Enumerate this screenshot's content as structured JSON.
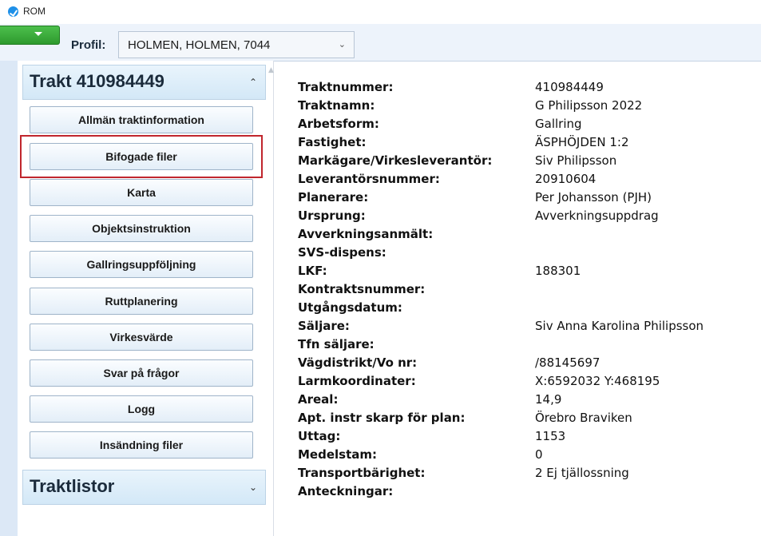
{
  "app": {
    "title": "ROM"
  },
  "toolbar": {
    "profile_label": "Profil:",
    "profile_value": "HOLMEN, HOLMEN, 7044"
  },
  "colors": {
    "accent_green": "#3aa83a",
    "selection_red": "#c0262d",
    "panel_blue": "#dce8f6"
  },
  "sidebar": {
    "trakt_header": "Trakt 410984449",
    "traktlistor_header": "Traktlistor",
    "selected_item": "Bifogade filer",
    "items": [
      {
        "label": "Allmän traktinformation"
      },
      {
        "label": "Bifogade filer"
      },
      {
        "label": "Karta"
      },
      {
        "label": "Objektsinstruktion"
      },
      {
        "label": "Gallringsuppföljning"
      },
      {
        "label": "Ruttplanering"
      },
      {
        "label": "Virkesvärde"
      },
      {
        "label": "Svar på frågor"
      },
      {
        "label": "Logg"
      },
      {
        "label": "Insändning filer"
      }
    ]
  },
  "details": [
    {
      "label": "Traktnummer:",
      "value": "410984449"
    },
    {
      "label": "Traktnamn:",
      "value": "G Philipsson 2022"
    },
    {
      "label": "Arbetsform:",
      "value": "Gallring"
    },
    {
      "label": "Fastighet:",
      "value": "ÄSPHÖJDEN 1:2"
    },
    {
      "label": "Markägare/Virkesleverantör:",
      "value": "Siv Philipsson"
    },
    {
      "label": "Leverantörsnummer:",
      "value": "20910604"
    },
    {
      "label": "Planerare:",
      "value": "Per Johansson (PJH)"
    },
    {
      "label": "Ursprung:",
      "value": "Avverkningsuppdrag"
    },
    {
      "label": "Avverkningsanmält:",
      "value": ""
    },
    {
      "label": "SVS-dispens:",
      "value": ""
    },
    {
      "label": "LKF:",
      "value": "188301"
    },
    {
      "label": "Kontraktsnummer:",
      "value": ""
    },
    {
      "label": "Utgångsdatum:",
      "value": ""
    },
    {
      "label": "Säljare:",
      "value": "Siv Anna Karolina Philipsson"
    },
    {
      "label": "Tfn säljare:",
      "value": ""
    },
    {
      "label": "Vägdistrikt/Vo nr:",
      "value": "/88145697"
    },
    {
      "label": "Larmkoordinater:",
      "value": "X:6592032 Y:468195"
    },
    {
      "label": "Areal:",
      "value": "14,9"
    },
    {
      "label": "Apt. instr skarp för plan:",
      "value": "Örebro Braviken"
    },
    {
      "label": "Uttag:",
      "value": "1153"
    },
    {
      "label": "Medelstam:",
      "value": "0"
    },
    {
      "label": "Transportbärighet:",
      "value": "2 Ej tjällossning"
    },
    {
      "label": "Anteckningar:",
      "value": ""
    }
  ]
}
